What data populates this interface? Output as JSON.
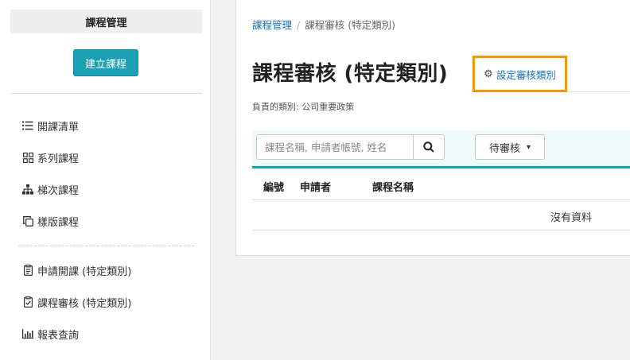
{
  "sidebar": {
    "header": "課程管理",
    "create_button": "建立課程",
    "group1": [
      {
        "label": "開課清單",
        "icon": "list-icon"
      },
      {
        "label": "系列課程",
        "icon": "grid-icon"
      },
      {
        "label": "梯次課程",
        "icon": "sitemap-icon"
      },
      {
        "label": "樣版課程",
        "icon": "copy-icon"
      }
    ],
    "group2": [
      {
        "label": "申請開課 (特定類別)",
        "icon": "clipboard-list-icon"
      },
      {
        "label": "課程審核 (特定類別)",
        "icon": "clipboard-check-icon"
      },
      {
        "label": "報表查詢",
        "icon": "bar-chart-icon"
      }
    ]
  },
  "breadcrumb": {
    "parent": "課程管理",
    "separator": "/",
    "current": "課程審核 (特定類別)"
  },
  "main": {
    "title": "課程審核 (特定類別)",
    "settings_link": "設定審核類別",
    "responsible": "負責的類別: 公司重要政策",
    "search_placeholder": "課程名稱, 申請者帳號, 姓名",
    "status_selected": "待審核",
    "table": {
      "columns": [
        "編號",
        "申請者",
        "課程名稱"
      ],
      "empty_message": "沒有資料"
    }
  },
  "colors": {
    "accent": "#1ba1b3",
    "link": "#1a73c5",
    "highlight_border": "#f0960f",
    "filter_bg": "#eefaf9"
  }
}
